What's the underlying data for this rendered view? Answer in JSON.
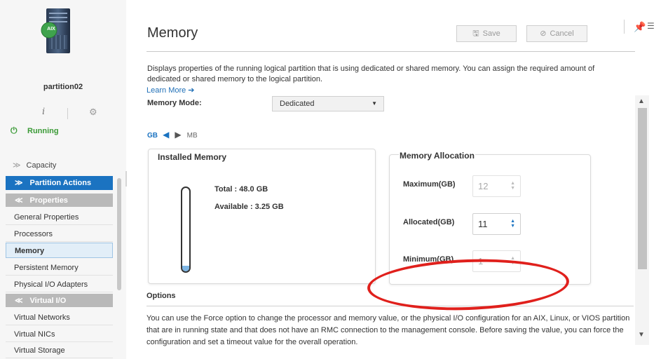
{
  "sidebar": {
    "server_icon": "aix-server-icon",
    "server_badge": "AIX",
    "partition_name": "partition02",
    "info_icon": "i",
    "status_label": "Running",
    "capacity_label": "Capacity",
    "partition_actions_label": "Partition Actions",
    "properties_label": "Properties",
    "properties_items": [
      {
        "label": "General Properties"
      },
      {
        "label": "Processors"
      },
      {
        "label": "Memory"
      },
      {
        "label": "Persistent Memory"
      },
      {
        "label": "Physical I/O Adapters"
      }
    ],
    "active_item": "Memory",
    "virtual_io_label": "Virtual I/O",
    "virtual_io_items": [
      {
        "label": "Virtual Networks"
      },
      {
        "label": "Virtual NICs"
      },
      {
        "label": "Virtual Storage"
      }
    ]
  },
  "header": {
    "title": "Memory",
    "save_label": "Save",
    "cancel_label": "Cancel"
  },
  "main": {
    "description": "Displays properties of the running logical partition that is using dedicated or shared memory. You can assign the required amount of dedicated or shared memory to the logical partition.",
    "learn_more": "Learn More ➔",
    "memory_mode_label": "Memory Mode:",
    "memory_mode_value": "Dedicated",
    "unit_gb": "GB",
    "unit_mb": "MB",
    "installed": {
      "title": "Installed Memory",
      "total": "Total : 48.0 GB",
      "available": "Available : 3.25 GB",
      "fill_fraction": 0.068
    },
    "allocation": {
      "title": "Memory Allocation",
      "maximum_label": "Maximum(GB)",
      "maximum_value": "12",
      "allocated_label": "Allocated(GB)",
      "allocated_value": "11",
      "minimum_label": "Minimum(GB)",
      "minimum_value": "1"
    },
    "options_title": "Options",
    "options_text": "You can use the Force option to change the processor and memory value, or the physical I/O configuration for an AIX, Linux, or VIOS partition that are in running state and that does not have an RMC connection to the management console. Before saving the value, you can force the configuration and set a timeout value for the overall operation."
  },
  "colors": {
    "accent": "#1b73c1",
    "running": "#3a9a36",
    "annotation": "#e0201c"
  }
}
